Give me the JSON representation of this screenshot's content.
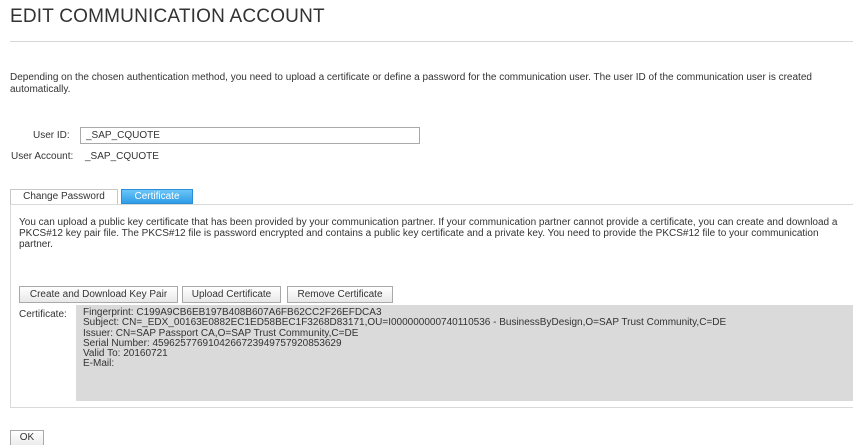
{
  "page": {
    "title": "EDIT COMMUNICATION ACCOUNT",
    "description": "Depending on the chosen authentication method, you need to upload a certificate or define a password for the communication user. The user ID of the communication user is created automatically."
  },
  "user": {
    "user_id_label": "User ID:",
    "user_id_value": "_SAP_CQUOTE",
    "user_account_label": "User Account:",
    "user_account_value": "_SAP_CQUOTE"
  },
  "tabs": [
    {
      "label": "Change Password",
      "selected": false
    },
    {
      "label": "Certificate",
      "selected": true
    }
  ],
  "certificate_panel": {
    "info_text": "You can upload a public key certificate that has been provided by your communication partner. If your communication partner cannot provide a certificate, you can create and download a PKCS#12 key pair file. The PKCS#12 file is password encrypted and contains a public key certificate and a private key.  You need to provide the PKCS#12 file to your communication partner.",
    "buttons": {
      "create_download": "Create and Download Key Pair",
      "upload": "Upload Certificate",
      "remove": "Remove Certificate"
    },
    "certificate_label": "Certificate:",
    "certificate_lines": [
      "Fingerprint:   C199A9CB6EB197B408B607A6FB62CC2F26EFDCA3",
      "Subject: CN=_EDX_00163E0882EC1ED58BEC1F3268D83171,OU=I000000000740110536 - BusinessByDesign,O=SAP Trust Community,C=DE",
      "Issuer:   CN=SAP Passport CA,O=SAP Trust Community,C=DE",
      "Serial Number: 4596257769104266723949757920853629",
      "Valid To: 20160721",
      "E-Mail:"
    ]
  },
  "footer": {
    "ok_label": "OK"
  },
  "colors": {
    "selected_tab_top": "#6cc4f7",
    "selected_tab_bottom": "#2e9de8",
    "certificate_box_bg": "#dadada"
  }
}
